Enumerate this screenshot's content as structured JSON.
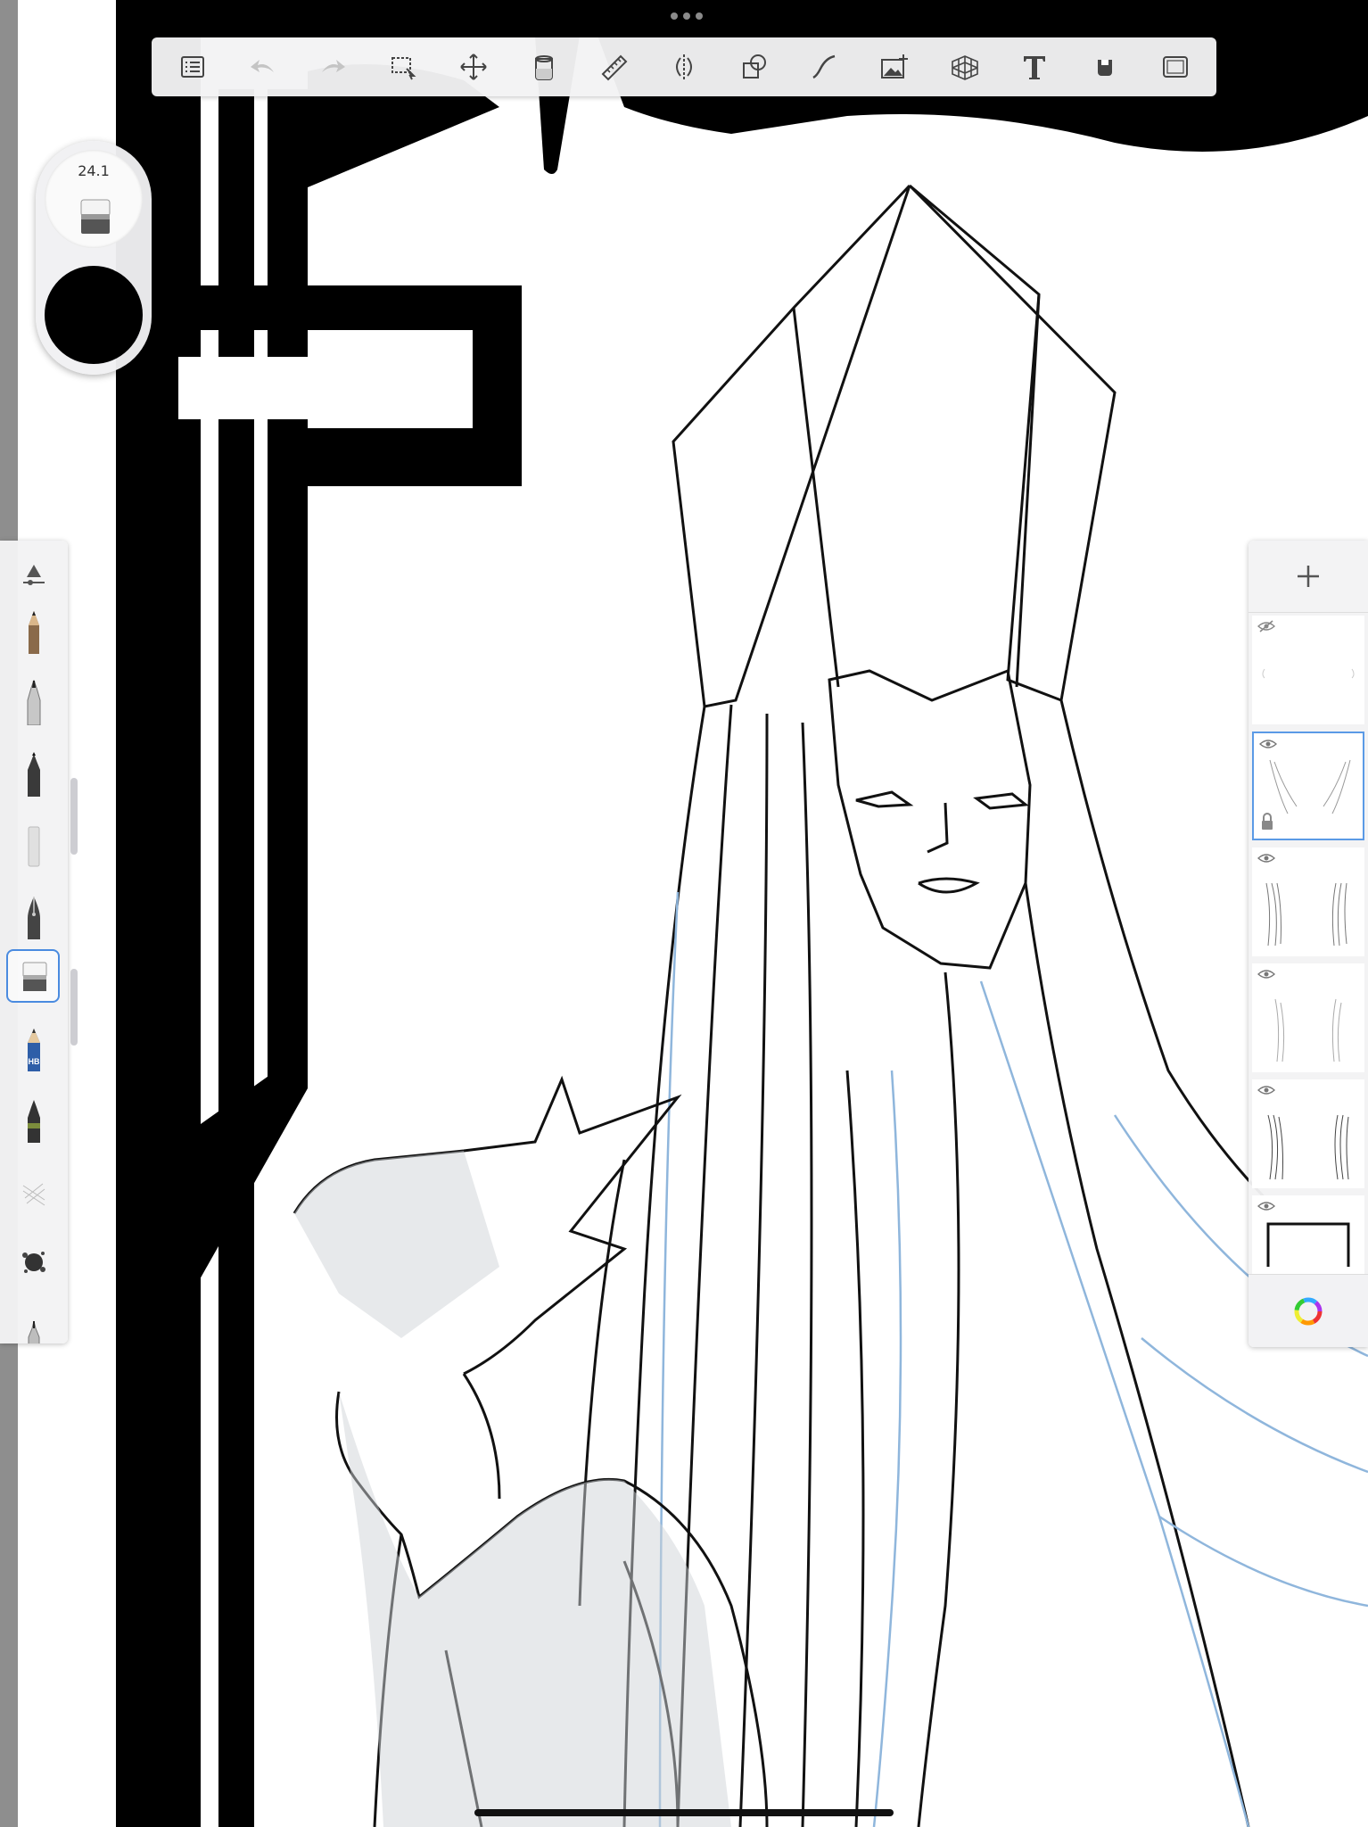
{
  "toolbar": {
    "items": [
      {
        "id": "menu",
        "icon": "list-icon"
      },
      {
        "id": "undo",
        "icon": "undo-arrow-icon"
      },
      {
        "id": "redo",
        "icon": "redo-arrow-icon"
      },
      {
        "id": "select",
        "icon": "selection-icon"
      },
      {
        "id": "transform",
        "icon": "move-arrows-icon"
      },
      {
        "id": "fill",
        "icon": "paint-bucket-icon"
      },
      {
        "id": "ruler",
        "icon": "ruler-icon"
      },
      {
        "id": "symmetry",
        "icon": "symmetry-icon"
      },
      {
        "id": "shapes",
        "icon": "shapes-icon"
      },
      {
        "id": "curve",
        "icon": "curve-icon"
      },
      {
        "id": "image",
        "icon": "add-image-icon"
      },
      {
        "id": "perspective",
        "icon": "perspective-grid-icon"
      },
      {
        "id": "text",
        "icon": "text-icon"
      },
      {
        "id": "fill-color",
        "icon": "color-fill-icon"
      },
      {
        "id": "fullscreen",
        "icon": "fullscreen-icon"
      }
    ]
  },
  "brush_puck": {
    "size": "24.1",
    "tool_icon": "eraser-icon",
    "current_color": "#000000"
  },
  "brush_library": {
    "items": [
      "pencil-icon",
      "fineliner-icon",
      "marker-icon",
      "smudge-icon",
      "fountain-pen-icon",
      "eraser-icon",
      "hb-pencil-icon",
      "ink-pen-icon",
      "texture-brush-icon",
      "splatter-brush-icon",
      "airbrush-icon"
    ],
    "selected": "eraser-icon"
  },
  "layers_panel": {
    "add_icon": "plus-icon",
    "layers": [
      {
        "visible": false,
        "selected": false
      },
      {
        "visible": true,
        "selected": true,
        "locked": true
      },
      {
        "visible": true,
        "selected": false
      },
      {
        "visible": true,
        "selected": false
      },
      {
        "visible": true,
        "selected": false
      },
      {
        "visible": true,
        "selected": false
      }
    ],
    "color_wheel_icon": "color-wheel-icon"
  },
  "colors": {
    "accent": "#4a8be0",
    "sketch_blue": "#8fb6dc",
    "ink": "#000000"
  }
}
